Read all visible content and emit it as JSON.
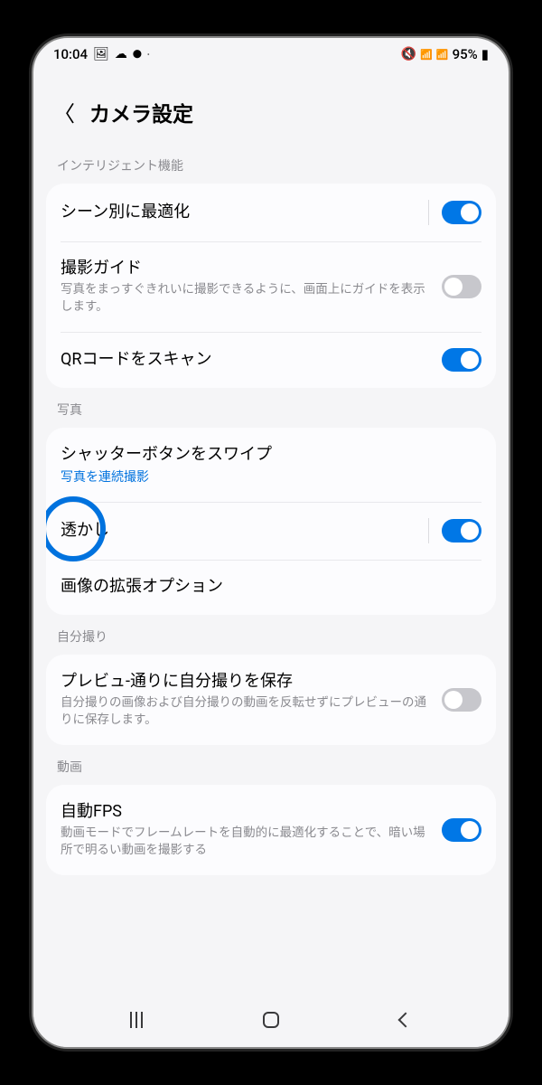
{
  "status": {
    "time": "10:04",
    "left_icons": [
      "🖼",
      "☁",
      "⬤",
      "•"
    ],
    "right_icons": [
      "🔇",
      "📶",
      "📶"
    ],
    "battery": "95%",
    "battery_icon": "▮"
  },
  "header": {
    "back_glyph": "〈",
    "title": "カメラ設定"
  },
  "sections": [
    {
      "label": "インテリジェント機能",
      "rows": [
        {
          "title": "シーン別に最適化",
          "toggle": "on",
          "sep": true
        },
        {
          "title": "撮影ガイド",
          "desc": "写真をまっすぐきれいに撮影できるように、画面上にガイドを表示します。",
          "toggle": "off"
        },
        {
          "title": "QRコードをスキャン",
          "toggle": "on"
        }
      ]
    },
    {
      "label": "写真",
      "rows": [
        {
          "title": "シャッターボタンをスワイプ",
          "link": "写真を連続撮影"
        },
        {
          "title": "透かし",
          "toggle": "on",
          "sep": true,
          "highlight": true
        },
        {
          "title": "画像の拡張オプション"
        }
      ]
    },
    {
      "label": "自分撮り",
      "rows": [
        {
          "title": "プレビュ-通りに自分撮りを保存",
          "desc": "自分撮りの画像および自分撮りの動画を反転せずにプレビューの通りに保存します。",
          "toggle": "off"
        }
      ]
    },
    {
      "label": "動画",
      "rows": [
        {
          "title": "自動FPS",
          "desc": "動画モードでフレームレートを自動的に最適化することで、暗い場所で明るい動画を撮影する",
          "toggle": "on"
        }
      ]
    }
  ]
}
